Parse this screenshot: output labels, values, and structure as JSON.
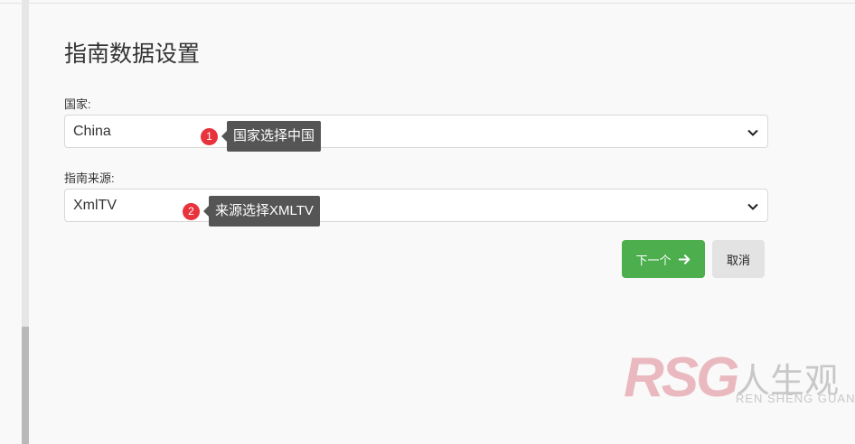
{
  "page": {
    "title": "指南数据设置"
  },
  "form": {
    "country": {
      "label": "国家:",
      "value": "China"
    },
    "source": {
      "label": "指南来源:",
      "value": "XmlTV"
    }
  },
  "annotations": [
    {
      "number": "1",
      "text": "国家选择中国"
    },
    {
      "number": "2",
      "text": "来源选择XMLTV"
    }
  ],
  "buttons": {
    "next_label": "下一个",
    "next_icon": "arrow-right-icon",
    "cancel_label": "取消"
  },
  "watermark": {
    "logo": "RSG",
    "chinese": "人生观",
    "english": "REN SHENG GUAN"
  },
  "colors": {
    "primary": "#4cae4c",
    "badge": "#e8333d",
    "tooltip": "#555555",
    "watermark": "#e9b9bf"
  }
}
